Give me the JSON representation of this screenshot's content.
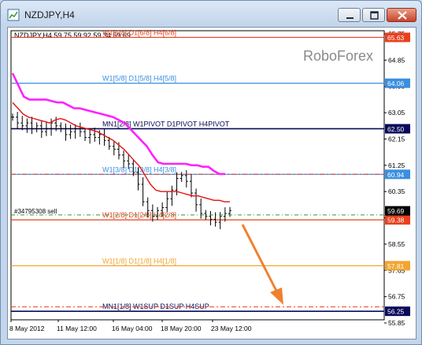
{
  "window": {
    "title": "NZDJPY,H4",
    "buttons": {
      "minimize": "minimize",
      "maximize": "maximize",
      "close": "close"
    }
  },
  "chart": {
    "header": "NZDJPY,H4  59.75 59.92 59.34 59.69",
    "watermark": "RoboForex",
    "order_label": "#34795308 sell",
    "arrow_color": "#f08030",
    "levels": [
      {
        "label": "W1[6/8] D1[6/8] H4[6/8]",
        "price": 65.63,
        "price_text": "65.63",
        "color": "#e8401c",
        "text_color": "#e8401c",
        "tag_bg": "#e8401c"
      },
      {
        "label": "W1[5/8] D1[5/8] H4[5/8]",
        "price": 64.06,
        "price_text": "64.06",
        "color": "#3a8fe0",
        "text_color": "#3a8fe0",
        "tag_bg": "#3a8fe0"
      },
      {
        "label": "MN1[2/8] W1PIVOT D1PIVOT H4PIVOT",
        "price": 62.5,
        "price_text": "62.50",
        "color": "#0a0a5a",
        "text_color": "#0a0a5a",
        "tag_bg": "#0a0a5a"
      },
      {
        "label": "W1[3/8] D1[3/8] H4[3/8]",
        "price": 60.94,
        "price_text": "60.94",
        "color": "#3a8fe0",
        "text_color": "#3a8fe0",
        "tag_bg": "#3a8fe0"
      },
      {
        "label": "W1[2/8] D1[2/8] H4[2/8]",
        "price": 59.38,
        "price_text": "59.38",
        "color": "#e8401c",
        "text_color": "#e8401c",
        "tag_bg": "#e8401c"
      },
      {
        "label": "W1[1/8] D1[1/8] H4[1/8]",
        "price": 57.81,
        "price_text": "57.81",
        "color": "#f2a530",
        "text_color": "#f2a530",
        "tag_bg": "#f2a530"
      },
      {
        "label": "MN1[1/8] W1SUP D1SUP H4SUP",
        "price": 56.25,
        "price_text": "56.25",
        "color": "#0a0a5a",
        "text_color": "#0a0a5a",
        "tag_bg": "#0a0a5a"
      }
    ],
    "current_price": {
      "price": 59.69,
      "price_text": "59.69",
      "tag_bg": "#000000"
    },
    "order_price": 59.55,
    "dashed_lines": [
      {
        "price": 60.94,
        "color": "#e8401c"
      },
      {
        "price": 56.4,
        "color": "#e8401c"
      }
    ],
    "y_ticks": [
      "65.75",
      "64.85",
      "63.90",
      "63.05",
      "62.15",
      "61.25",
      "60.35",
      "59.45",
      "58.55",
      "57.65",
      "56.75",
      "55.85"
    ],
    "x_ticks": [
      "8 May 2012",
      "11 May 12:00",
      "16 May 04:00",
      "18 May 20:00",
      "23 May 12:00"
    ]
  },
  "chart_data": {
    "type": "line",
    "title": "NZDJPY,H4",
    "series": [
      {
        "name": "",
        "values": [
          62.9,
          62.7,
          62.6,
          62.7,
          62.5,
          62.6,
          62.4,
          62.5,
          62.7,
          62.6,
          62.5,
          62.3,
          62.4,
          62.5,
          62.4,
          62.2,
          62.3,
          62.2,
          62.3,
          62.1,
          61.9,
          61.8,
          61.6,
          61.4,
          61.3,
          61.0,
          60.6,
          60.0,
          59.7,
          59.5,
          59.7,
          59.8,
          60.1,
          60.4,
          60.8,
          60.9,
          60.7,
          60.3,
          59.9,
          59.6,
          59.5,
          59.4,
          59.3,
          59.5,
          59.6,
          59.7
        ]
      },
      {
        "name": "",
        "values": [
          63.4,
          63.2,
          63.0,
          62.9,
          62.85,
          62.8,
          62.75,
          62.7,
          62.8,
          62.85,
          62.8,
          62.7,
          62.6,
          62.55,
          62.5,
          62.45,
          62.4,
          62.3,
          62.2,
          62.1,
          61.95,
          61.8,
          61.6,
          61.4,
          61.2,
          60.9,
          60.6,
          60.4,
          60.35,
          60.35,
          60.35,
          60.35,
          60.3,
          60.25,
          60.2,
          60.2,
          60.15,
          60.1,
          60.05,
          60.05,
          60.0,
          60.0
        ]
      },
      {
        "name": "",
        "values": [
          64.4,
          64.0,
          63.6,
          63.5,
          63.5,
          63.5,
          63.5,
          63.45,
          63.4,
          63.4,
          63.3,
          63.2,
          63.2,
          63.15,
          63.1,
          63.05,
          63.0,
          62.95,
          62.9,
          62.8,
          62.7,
          62.5,
          62.3,
          62.1,
          61.9,
          61.6,
          61.35,
          61.3,
          61.3,
          61.3,
          61.3,
          61.3,
          61.25,
          61.25,
          61.2,
          61.2,
          61.05,
          60.95,
          60.95
        ]
      }
    ],
    "ylim": [
      55.85,
      65.75
    ]
  }
}
